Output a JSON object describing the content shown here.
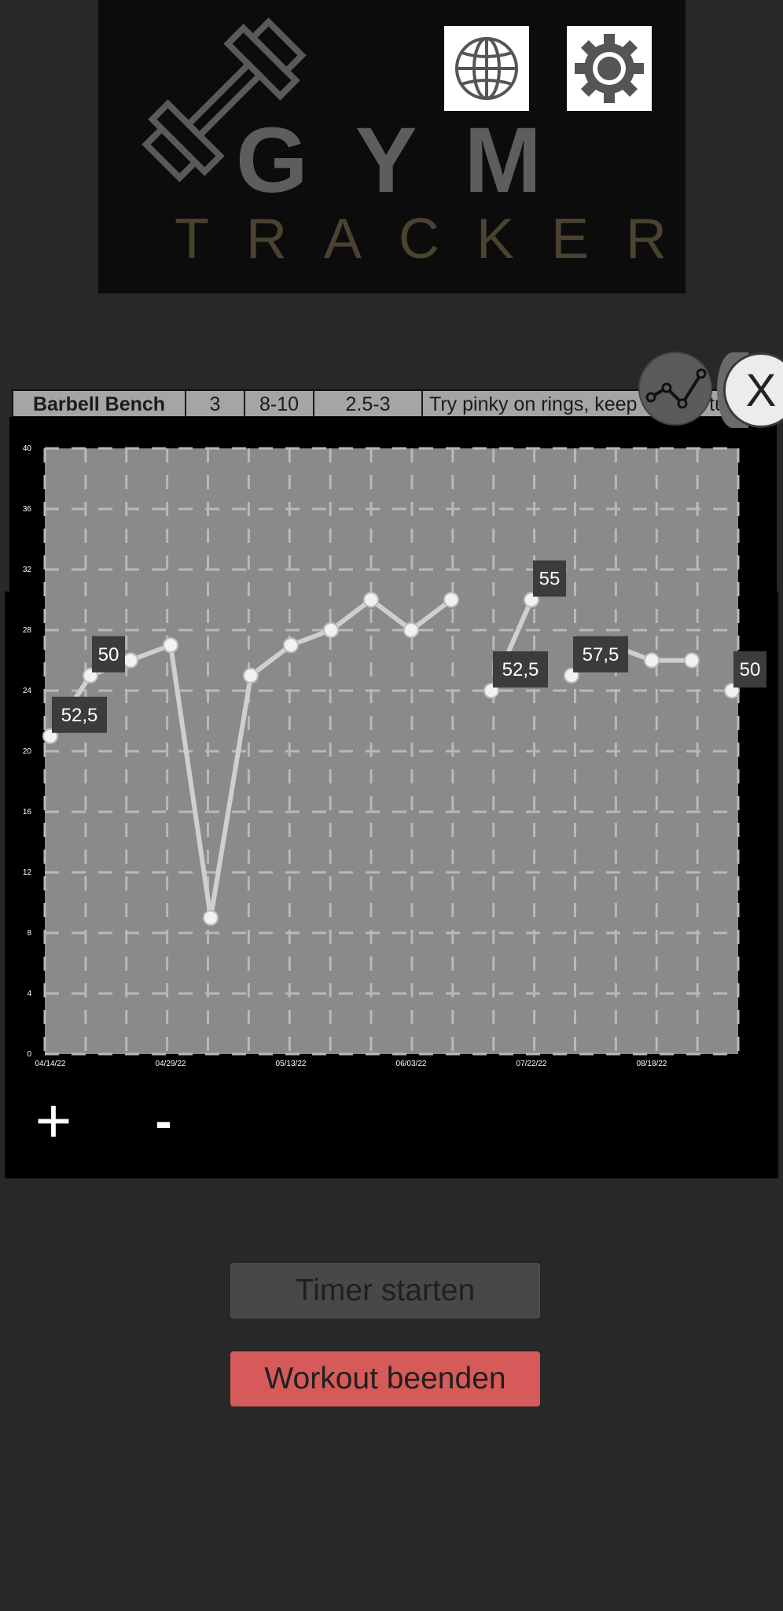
{
  "header": {
    "logo_word_1": "GYM",
    "logo_word_2": "TRACKER",
    "language_icon": "globe-icon",
    "settings_icon": "gear-icon"
  },
  "exercise": {
    "name": "Barbell Bench",
    "sets": "3",
    "reps": "8-10",
    "rir": "2.5-3",
    "note": "Try pinky on rings, keep elbows tucked"
  },
  "chart_toggle_icon": "line-chart-icon",
  "close_label": "X",
  "chart_data": {
    "type": "line",
    "ylim": [
      0,
      40
    ],
    "y_ticks": [
      "0",
      "4",
      "8",
      "12",
      "16",
      "20",
      "24",
      "28",
      "32",
      "36",
      "40"
    ],
    "x_tick_labels": [
      "04/14/22",
      "04/29/22",
      "05/13/22",
      "06/03/22",
      "07/22/22",
      "08/18/22"
    ],
    "grid": true,
    "segments": [
      {
        "values": [
          21,
          25,
          26,
          27,
          9,
          25,
          27,
          28,
          30,
          28,
          30
        ],
        "start_index": 0
      },
      {
        "values": [
          24,
          30
        ],
        "start_index": 11
      },
      {
        "values": [
          25,
          27,
          26,
          26
        ],
        "start_index": 13
      },
      {
        "values": [
          24
        ],
        "start_index": 17
      }
    ],
    "data_labels": [
      {
        "index": 0,
        "text": "52,5"
      },
      {
        "index": 1,
        "text": "50"
      },
      {
        "index": 11,
        "text": "52,5"
      },
      {
        "index": 12,
        "text": "55"
      },
      {
        "index": 13,
        "text": "57,5"
      },
      {
        "index": 17,
        "text": "50"
      }
    ]
  },
  "controls": {
    "plus_label": "+",
    "minus_label": "-"
  },
  "actions": {
    "timer_label": "Timer starten",
    "end_workout_label": "Workout beenden"
  },
  "colors": {
    "background": "#282828",
    "end_workout": "#d65a5a",
    "plot_area": "#8a8a8a"
  }
}
